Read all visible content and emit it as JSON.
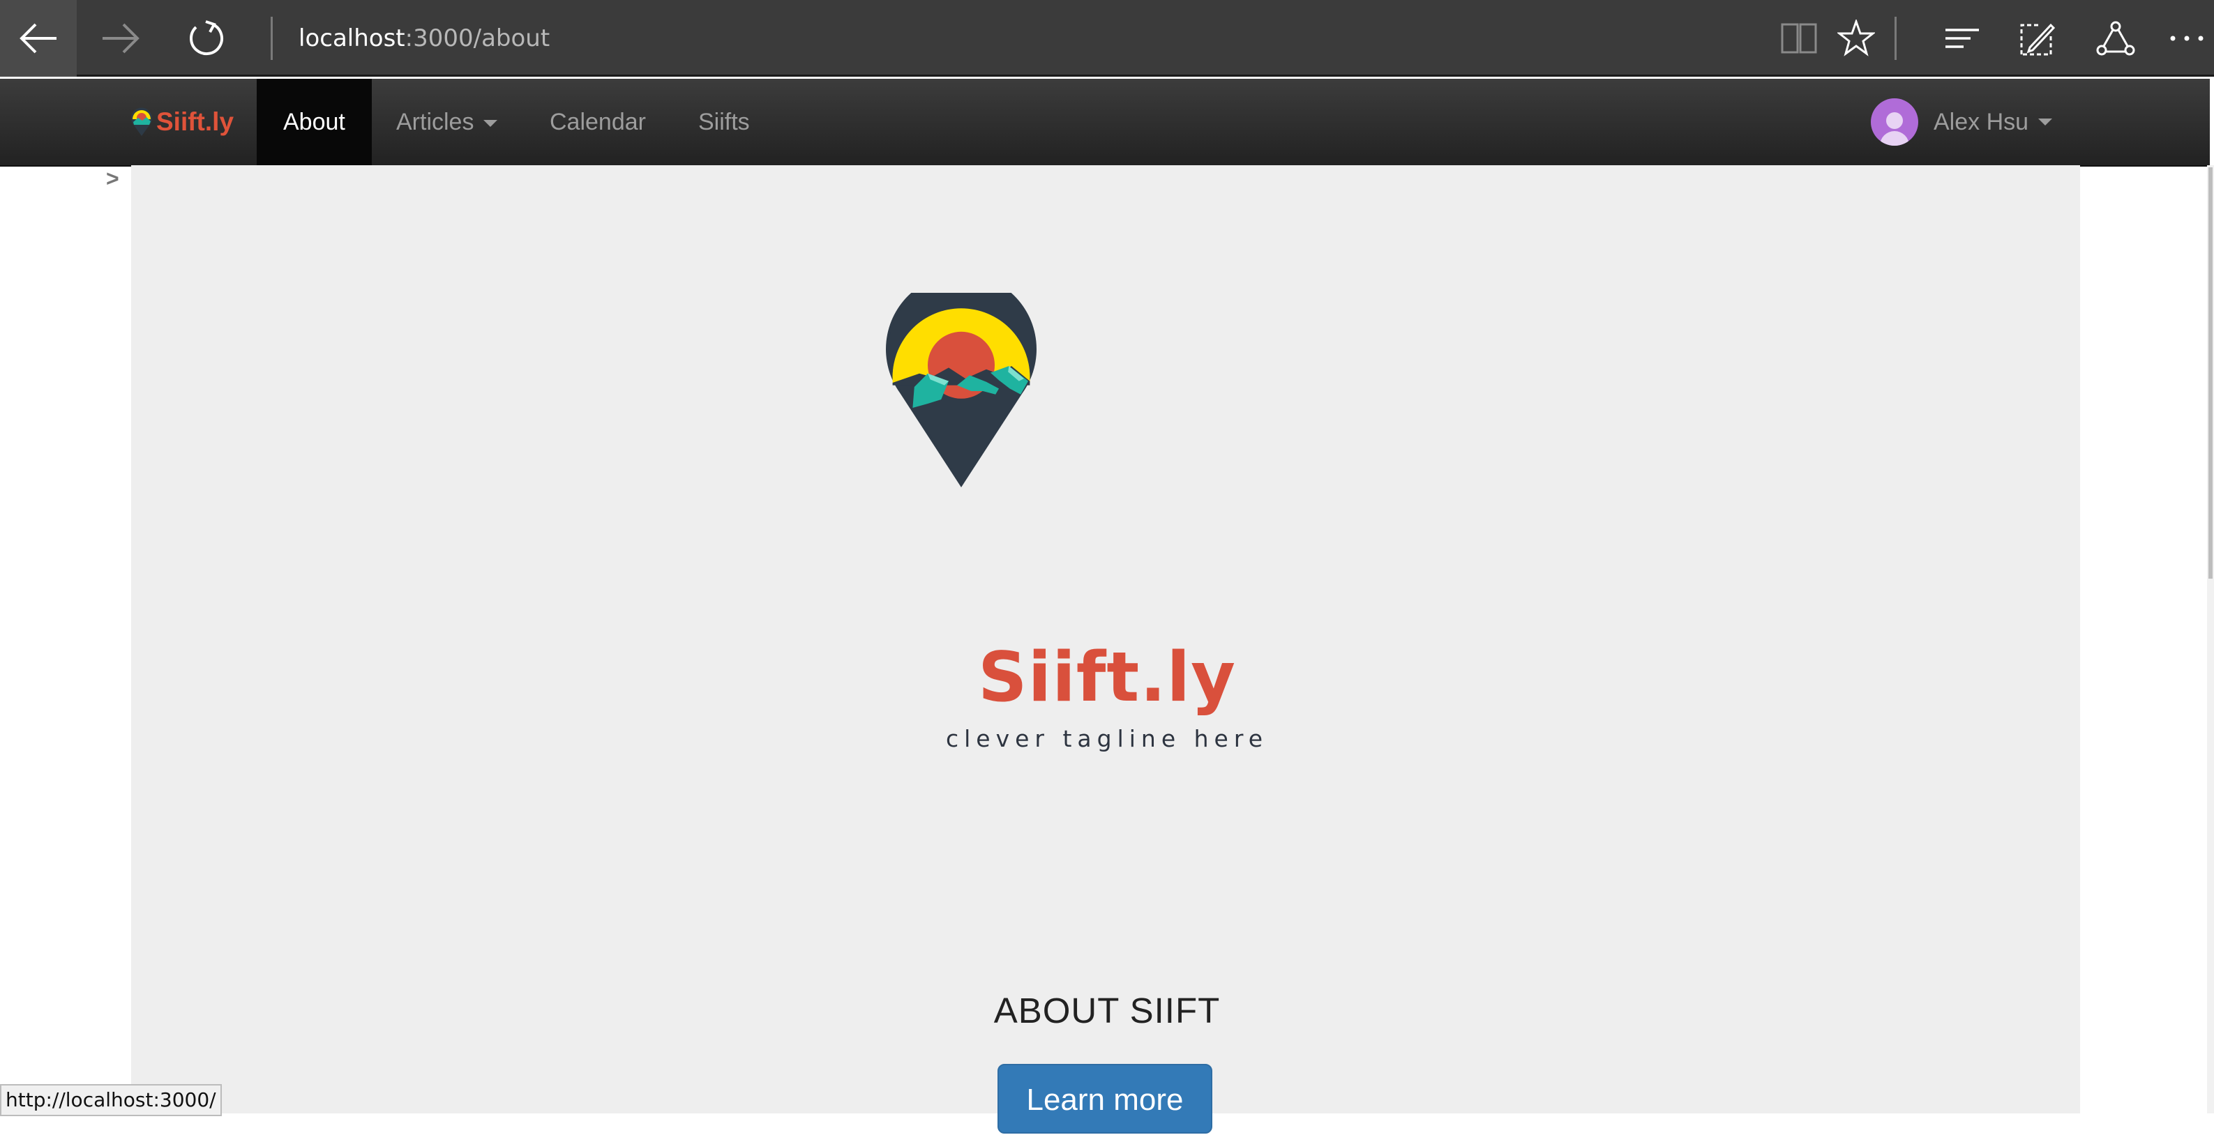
{
  "browser": {
    "url_host": "localhost",
    "url_path": ":3000/about",
    "status_url": "http://localhost:3000/"
  },
  "navbar": {
    "brand": "Siift.ly",
    "items": [
      {
        "label": "About",
        "active": true
      },
      {
        "label": "Articles",
        "dropdown": true
      },
      {
        "label": "Calendar"
      },
      {
        "label": "Siifts"
      }
    ],
    "user": "Alex Hsu"
  },
  "hero": {
    "logo_text": "Siift.ly",
    "tagline": "clever tagline here",
    "breadcrumb_marker": ">"
  },
  "about": {
    "heading": "ABOUT SIIFT",
    "button": "Learn more"
  },
  "colors": {
    "brand_red": "#d9503c",
    "button_blue": "#337ab7",
    "navbar_dark": "#222222",
    "jumbotron_bg": "#eeeeee"
  }
}
